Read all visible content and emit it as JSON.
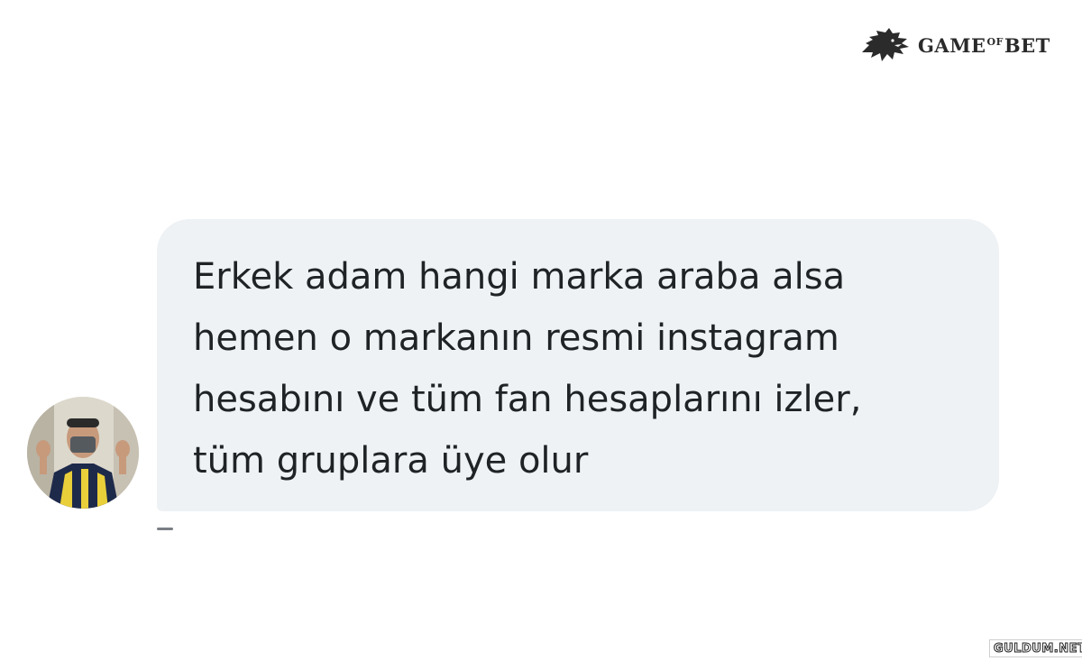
{
  "watermark": {
    "brand_prefix": "GAME",
    "brand_of": "OF",
    "brand_suffix": "BET",
    "brand_icon": "wolf-head-icon",
    "footer_text": "GULDUM.NET"
  },
  "message": {
    "text": "Erkek adam hangi marka araba alsa\nhemen o markanın resmi instagram\nhesabını ve tüm fan hesaplarını izler,\ntüm gruplara üye olur",
    "bubble_color": "#eef2f5",
    "text_color": "#1f2326",
    "avatar": "user-avatar"
  }
}
